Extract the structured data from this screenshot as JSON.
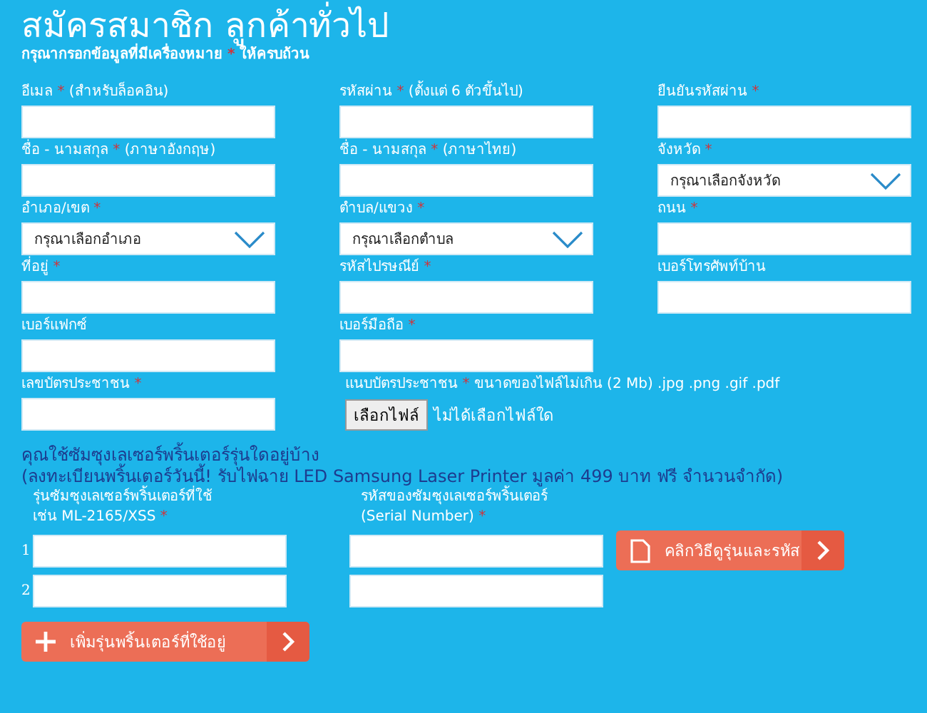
{
  "title": "สมัครสมาชิก ลูกค้าทั่วไป",
  "subtitle": {
    "before": "กรุณากรอกข้อมูลที่มีเครื่องหมาย",
    "mark": "*",
    "after": "ให้ครบถ้วน"
  },
  "fields": [
    {
      "kind": "text",
      "label": "อีเมล",
      "required": true,
      "note": "(สำหรับล็อคอิน)"
    },
    {
      "kind": "text",
      "label": "รหัสผ่าน",
      "required": true,
      "note": "(ตั้งแต่ 6 ตัวขึ้นไป)"
    },
    {
      "kind": "text",
      "label": "ยืนยันรหัสผ่าน",
      "required": true
    },
    {
      "kind": "text",
      "label": "ชื่อ - นามสกุล",
      "required": true,
      "note": "(ภาษาอังกฤษ)"
    },
    {
      "kind": "text",
      "label": "ชื่อ - นามสกุล",
      "required": true,
      "note": "(ภาษาไทย)"
    },
    {
      "kind": "select",
      "label": "จังหวัด",
      "required": true,
      "value": "กรุณาเลือกจังหวัด"
    },
    {
      "kind": "select",
      "label": "อำเภอ/เขต",
      "required": true,
      "value": "กรุณาเลือกอำเภอ"
    },
    {
      "kind": "select",
      "label": "ตำบล/แขวง",
      "required": true,
      "value": "กรุณาเลือกตำบล"
    },
    {
      "kind": "text",
      "label": "ถนน",
      "required": true
    },
    {
      "kind": "text",
      "label": "ที่อยู่",
      "required": true
    },
    {
      "kind": "text",
      "label": "รหัสไปรษณีย์",
      "required": true
    },
    {
      "kind": "text",
      "label": "เบอร์โทรศัพท์บ้าน",
      "required": false
    },
    {
      "kind": "text",
      "label": "เบอร์แฟกซ์",
      "required": false
    },
    {
      "kind": "text",
      "label": "เบอร์มือถือ",
      "required": true
    },
    {
      "kind": "blank"
    },
    {
      "kind": "text",
      "label": "เลขบัตรประชาชน",
      "required": true
    },
    {
      "kind": "file",
      "label": "แนบบัตรประชาชน",
      "required": true,
      "note": "ขนาดของไฟล์ไม่เกิน (2 Mb) .jpg .png .gif .pdf",
      "button": "เลือกไฟล์",
      "status": "ไม่ได้เลือกไฟล์ใด"
    }
  ],
  "printer": {
    "heading": [
      "คุณใช้ซัมซุงเลเซอร์พริ้นเตอร์รุ่นใดอยู่บ้าง",
      "(ลงทะเบียนพริ้นเตอร์วันนี้! รับไฟฉาย LED Samsung Laser Printer มูลค่า 499 บาท ฟรี จำนวนจำกัด)"
    ],
    "model_label": [
      "รุ่นซัมซุงเลเซอร์พริ้นเตอร์ที่ใช้",
      "เช่น ML-2165/XSS"
    ],
    "serial_label": [
      "รหัสของซัมซุงเลเซอร์พริ้นเตอร์",
      "(Serial Number)"
    ],
    "rows": [
      {
        "number": "1"
      },
      {
        "number": "2"
      }
    ],
    "guide_button": "คลิกวิธีดูรุ่นและรหัส",
    "add_button": "เพิ่มรุ่นพริ้นเตอร์ที่ใช้อยู่"
  }
}
